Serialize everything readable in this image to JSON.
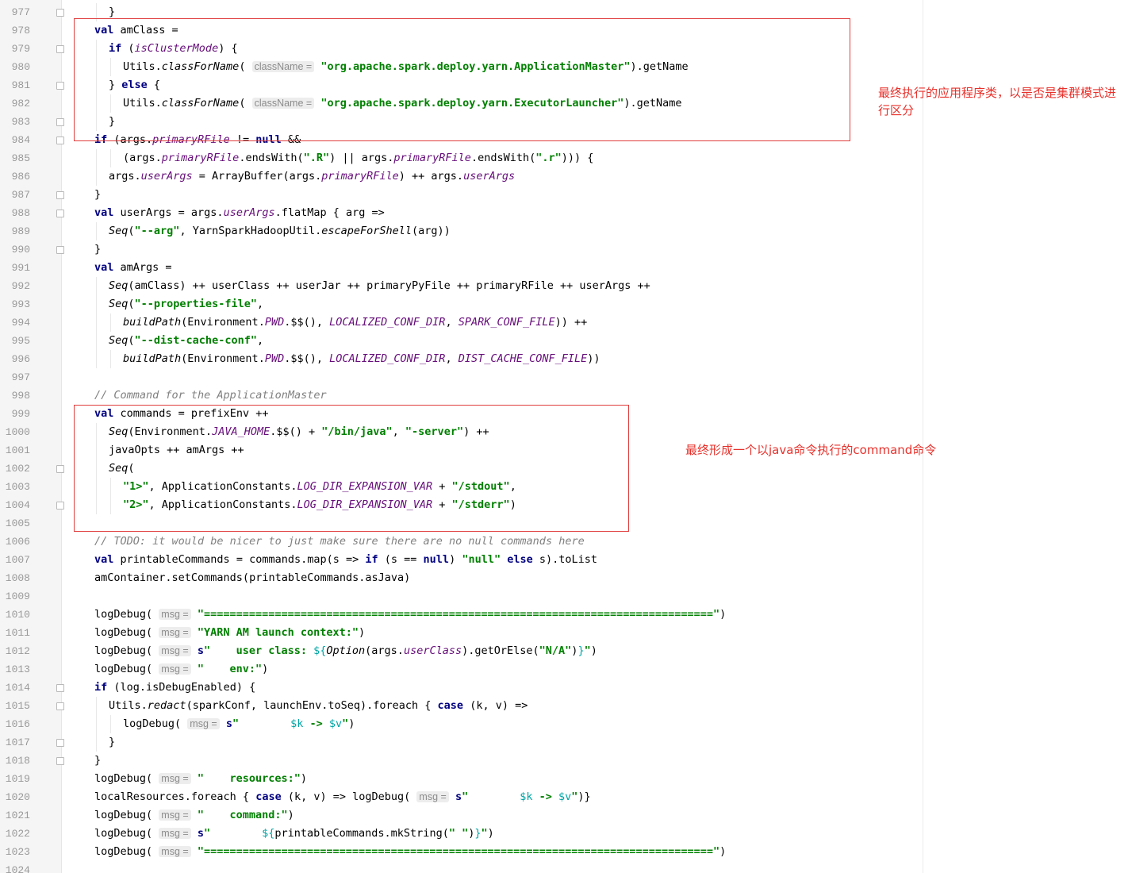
{
  "editor": {
    "lines": [
      {
        "n": "977",
        "i": 1,
        "f": true,
        "t": [
          {
            "x": "}"
          }
        ]
      },
      {
        "n": "978",
        "i": 0,
        "f": false,
        "t": [
          {
            "k": "kw",
            "x": "val"
          },
          {
            "x": " amClass ="
          }
        ]
      },
      {
        "n": "979",
        "i": 1,
        "f": true,
        "t": [
          {
            "k": "kw",
            "x": "if"
          },
          {
            "x": " ("
          },
          {
            "k": "fld",
            "x": "isClusterMode"
          },
          {
            "x": ") {"
          }
        ]
      },
      {
        "n": "980",
        "i": 2,
        "f": false,
        "t": [
          {
            "x": "Utils."
          },
          {
            "k": "fn",
            "x": "classForName"
          },
          {
            "x": "( "
          },
          {
            "k": "hint",
            "x": "className ="
          },
          {
            "x": " "
          },
          {
            "k": "str",
            "x": "\"org.apache.spark.deploy.yarn.ApplicationMaster\""
          },
          {
            "x": ").getName"
          }
        ]
      },
      {
        "n": "981",
        "i": 1,
        "f": true,
        "t": [
          {
            "x": "} "
          },
          {
            "k": "kw",
            "x": "else"
          },
          {
            "x": " {"
          }
        ]
      },
      {
        "n": "982",
        "i": 2,
        "f": false,
        "t": [
          {
            "x": "Utils."
          },
          {
            "k": "fn",
            "x": "classForName"
          },
          {
            "x": "( "
          },
          {
            "k": "hint",
            "x": "className ="
          },
          {
            "x": " "
          },
          {
            "k": "str",
            "x": "\"org.apache.spark.deploy.yarn.ExecutorLauncher\""
          },
          {
            "x": ").getName"
          }
        ]
      },
      {
        "n": "983",
        "i": 1,
        "f": true,
        "t": [
          {
            "x": "}"
          }
        ]
      },
      {
        "n": "984",
        "i": 0,
        "f": true,
        "t": [
          {
            "k": "kw",
            "x": "if"
          },
          {
            "x": " (args."
          },
          {
            "k": "fld",
            "x": "primaryRFile"
          },
          {
            "x": " != "
          },
          {
            "k": "kw",
            "x": "null"
          },
          {
            "x": " &&"
          }
        ]
      },
      {
        "n": "985",
        "i": 2,
        "f": false,
        "t": [
          {
            "x": "(args."
          },
          {
            "k": "fld",
            "x": "primaryRFile"
          },
          {
            "x": ".endsWith("
          },
          {
            "k": "str",
            "x": "\".R\""
          },
          {
            "x": ") || args."
          },
          {
            "k": "fld",
            "x": "primaryRFile"
          },
          {
            "x": ".endsWith("
          },
          {
            "k": "str",
            "x": "\".r\""
          },
          {
            "x": "))) {"
          }
        ]
      },
      {
        "n": "986",
        "i": 1,
        "f": false,
        "t": [
          {
            "x": "args."
          },
          {
            "k": "fld",
            "x": "userArgs"
          },
          {
            "x": " = ArrayBuffer(args."
          },
          {
            "k": "fld",
            "x": "primaryRFile"
          },
          {
            "x": ") ++ args."
          },
          {
            "k": "fld",
            "x": "userArgs"
          }
        ]
      },
      {
        "n": "987",
        "i": 0,
        "f": true,
        "t": [
          {
            "x": "}"
          }
        ]
      },
      {
        "n": "988",
        "i": 0,
        "f": true,
        "t": [
          {
            "k": "kw",
            "x": "val"
          },
          {
            "x": " userArgs = args."
          },
          {
            "k": "fld",
            "x": "userArgs"
          },
          {
            "x": ".flatMap { arg =>"
          }
        ]
      },
      {
        "n": "989",
        "i": 1,
        "f": false,
        "t": [
          {
            "k": "fn",
            "x": "Seq"
          },
          {
            "x": "("
          },
          {
            "k": "str",
            "x": "\"--arg\""
          },
          {
            "x": ", YarnSparkHadoopUtil."
          },
          {
            "k": "fn",
            "x": "escapeForShell"
          },
          {
            "x": "(arg))"
          }
        ]
      },
      {
        "n": "990",
        "i": 0,
        "f": true,
        "t": [
          {
            "x": "}"
          }
        ]
      },
      {
        "n": "991",
        "i": 0,
        "f": false,
        "t": [
          {
            "k": "kw",
            "x": "val"
          },
          {
            "x": " amArgs ="
          }
        ]
      },
      {
        "n": "992",
        "i": 1,
        "f": false,
        "t": [
          {
            "k": "fn",
            "x": "Seq"
          },
          {
            "x": "(amClass) ++ userClass ++ userJar ++ primaryPyFile ++ primaryRFile ++ userArgs ++"
          }
        ]
      },
      {
        "n": "993",
        "i": 1,
        "f": false,
        "t": [
          {
            "k": "fn",
            "x": "Seq"
          },
          {
            "x": "("
          },
          {
            "k": "str",
            "x": "\"--properties-file\""
          },
          {
            "x": ","
          }
        ]
      },
      {
        "n": "994",
        "i": 2,
        "f": false,
        "t": [
          {
            "k": "fn",
            "x": "buildPath"
          },
          {
            "x": "(Environment."
          },
          {
            "k": "fld",
            "x": "PWD"
          },
          {
            "x": ".$$(), "
          },
          {
            "k": "fld",
            "x": "LOCALIZED_CONF_DIR"
          },
          {
            "x": ", "
          },
          {
            "k": "fld",
            "x": "SPARK_CONF_FILE"
          },
          {
            "x": ")) ++"
          }
        ]
      },
      {
        "n": "995",
        "i": 1,
        "f": false,
        "t": [
          {
            "k": "fn",
            "x": "Seq"
          },
          {
            "x": "("
          },
          {
            "k": "str",
            "x": "\"--dist-cache-conf\""
          },
          {
            "x": ","
          }
        ]
      },
      {
        "n": "996",
        "i": 2,
        "f": false,
        "t": [
          {
            "k": "fn",
            "x": "buildPath"
          },
          {
            "x": "(Environment."
          },
          {
            "k": "fld",
            "x": "PWD"
          },
          {
            "x": ".$$(), "
          },
          {
            "k": "fld",
            "x": "LOCALIZED_CONF_DIR"
          },
          {
            "x": ", "
          },
          {
            "k": "fld",
            "x": "DIST_CACHE_CONF_FILE"
          },
          {
            "x": "))"
          }
        ]
      },
      {
        "n": "997",
        "i": 0,
        "f": false,
        "t": []
      },
      {
        "n": "998",
        "i": 0,
        "f": false,
        "t": [
          {
            "k": "cm",
            "x": "// Command for the ApplicationMaster"
          }
        ]
      },
      {
        "n": "999",
        "i": 0,
        "f": false,
        "t": [
          {
            "k": "kw",
            "x": "val"
          },
          {
            "x": " commands = prefixEnv ++"
          }
        ]
      },
      {
        "n": "1000",
        "i": 1,
        "f": false,
        "t": [
          {
            "k": "fn",
            "x": "Seq"
          },
          {
            "x": "(Environment."
          },
          {
            "k": "fld",
            "x": "JAVA_HOME"
          },
          {
            "x": ".$$() + "
          },
          {
            "k": "str",
            "x": "\"/bin/java\""
          },
          {
            "x": ", "
          },
          {
            "k": "str",
            "x": "\"-server\""
          },
          {
            "x": ") ++"
          }
        ]
      },
      {
        "n": "1001",
        "i": 1,
        "f": false,
        "t": [
          {
            "x": "javaOpts ++ amArgs ++"
          }
        ]
      },
      {
        "n": "1002",
        "i": 1,
        "f": true,
        "t": [
          {
            "k": "fn",
            "x": "Seq"
          },
          {
            "x": "("
          }
        ]
      },
      {
        "n": "1003",
        "i": 2,
        "f": false,
        "t": [
          {
            "k": "str",
            "x": "\"1>\""
          },
          {
            "x": ", ApplicationConstants."
          },
          {
            "k": "fld",
            "x": "LOG_DIR_EXPANSION_VAR"
          },
          {
            "x": " + "
          },
          {
            "k": "str",
            "x": "\"/stdout\""
          },
          {
            "x": ","
          }
        ]
      },
      {
        "n": "1004",
        "i": 2,
        "f": true,
        "t": [
          {
            "k": "str",
            "x": "\"2>\""
          },
          {
            "x": ", ApplicationConstants."
          },
          {
            "k": "fld",
            "x": "LOG_DIR_EXPANSION_VAR"
          },
          {
            "x": " + "
          },
          {
            "k": "str",
            "x": "\"/stderr\""
          },
          {
            "x": ")"
          }
        ]
      },
      {
        "n": "1005",
        "i": 0,
        "f": false,
        "t": []
      },
      {
        "n": "1006",
        "i": 0,
        "f": false,
        "t": [
          {
            "k": "cm",
            "x": "// TODO: it would be nicer to just make sure there are no null commands here"
          }
        ]
      },
      {
        "n": "1007",
        "i": 0,
        "f": false,
        "t": [
          {
            "k": "kw",
            "x": "val"
          },
          {
            "x": " printableCommands = commands.map(s => "
          },
          {
            "k": "kw",
            "x": "if"
          },
          {
            "x": " (s == "
          },
          {
            "k": "kw",
            "x": "null"
          },
          {
            "x": ") "
          },
          {
            "k": "str",
            "x": "\"null\""
          },
          {
            "x": " "
          },
          {
            "k": "kw",
            "x": "else"
          },
          {
            "x": " s).toList"
          }
        ]
      },
      {
        "n": "1008",
        "i": 0,
        "f": false,
        "t": [
          {
            "x": "amContainer.setCommands(printableCommands.asJava)"
          }
        ]
      },
      {
        "n": "1009",
        "i": 0,
        "f": false,
        "t": []
      },
      {
        "n": "1010",
        "i": 0,
        "f": false,
        "t": [
          {
            "x": "logDebug( "
          },
          {
            "k": "hint",
            "x": "msg ="
          },
          {
            "x": " "
          },
          {
            "k": "str",
            "x": "\"===============================================================================\""
          },
          {
            "x": ")"
          }
        ]
      },
      {
        "n": "1011",
        "i": 0,
        "f": false,
        "t": [
          {
            "x": "logDebug( "
          },
          {
            "k": "hint",
            "x": "msg ="
          },
          {
            "x": " "
          },
          {
            "k": "str",
            "x": "\"YARN AM launch context:\""
          },
          {
            "x": ")"
          }
        ]
      },
      {
        "n": "1012",
        "i": 0,
        "f": false,
        "t": [
          {
            "x": "logDebug( "
          },
          {
            "k": "hint",
            "x": "msg ="
          },
          {
            "x": " "
          },
          {
            "k": "kw",
            "x": "s"
          },
          {
            "k": "str",
            "x": "\"    user class: "
          },
          {
            "k": "ip",
            "x": "${"
          },
          {
            "k": "fn",
            "x": "Option"
          },
          {
            "x": "(args."
          },
          {
            "k": "fld",
            "x": "userClass"
          },
          {
            "x": ").getOrElse("
          },
          {
            "k": "str",
            "x": "\"N/A\""
          },
          {
            "x": ")"
          },
          {
            "k": "ip",
            "x": "}"
          },
          {
            "k": "str",
            "x": "\""
          },
          {
            "x": ")"
          }
        ]
      },
      {
        "n": "1013",
        "i": 0,
        "f": false,
        "t": [
          {
            "x": "logDebug( "
          },
          {
            "k": "hint",
            "x": "msg ="
          },
          {
            "x": " "
          },
          {
            "k": "str",
            "x": "\"    env:\""
          },
          {
            "x": ")"
          }
        ]
      },
      {
        "n": "1014",
        "i": 0,
        "f": true,
        "t": [
          {
            "k": "kw",
            "x": "if"
          },
          {
            "x": " (log.isDebugEnabled) {"
          }
        ]
      },
      {
        "n": "1015",
        "i": 1,
        "f": true,
        "t": [
          {
            "x": "Utils."
          },
          {
            "k": "fn",
            "x": "redact"
          },
          {
            "x": "(sparkConf, launchEnv.toSeq).foreach { "
          },
          {
            "k": "kw",
            "x": "case"
          },
          {
            "x": " (k, v) =>"
          }
        ]
      },
      {
        "n": "1016",
        "i": 2,
        "f": false,
        "t": [
          {
            "x": "logDebug( "
          },
          {
            "k": "hint",
            "x": "msg ="
          },
          {
            "x": " "
          },
          {
            "k": "kw",
            "x": "s"
          },
          {
            "k": "str",
            "x": "\"        "
          },
          {
            "k": "ip",
            "x": "$k"
          },
          {
            "k": "str",
            "x": " -> "
          },
          {
            "k": "ip",
            "x": "$v"
          },
          {
            "k": "str",
            "x": "\""
          },
          {
            "x": ")"
          }
        ]
      },
      {
        "n": "1017",
        "i": 1,
        "f": true,
        "t": [
          {
            "x": "}"
          }
        ]
      },
      {
        "n": "1018",
        "i": 0,
        "f": true,
        "t": [
          {
            "x": "}"
          }
        ]
      },
      {
        "n": "1019",
        "i": 0,
        "f": false,
        "t": [
          {
            "x": "logDebug( "
          },
          {
            "k": "hint",
            "x": "msg ="
          },
          {
            "x": " "
          },
          {
            "k": "str",
            "x": "\"    resources:\""
          },
          {
            "x": ")"
          }
        ]
      },
      {
        "n": "1020",
        "i": 0,
        "f": false,
        "t": [
          {
            "x": "localResources.foreach { "
          },
          {
            "k": "kw",
            "x": "case"
          },
          {
            "x": " (k, v) => logDebug( "
          },
          {
            "k": "hint",
            "x": "msg ="
          },
          {
            "x": " "
          },
          {
            "k": "kw",
            "x": "s"
          },
          {
            "k": "str",
            "x": "\"        "
          },
          {
            "k": "ip",
            "x": "$k"
          },
          {
            "k": "str",
            "x": " -> "
          },
          {
            "k": "ip",
            "x": "$v"
          },
          {
            "k": "str",
            "x": "\""
          },
          {
            "x": ")}"
          }
        ]
      },
      {
        "n": "1021",
        "i": 0,
        "f": false,
        "t": [
          {
            "x": "logDebug( "
          },
          {
            "k": "hint",
            "x": "msg ="
          },
          {
            "x": " "
          },
          {
            "k": "str",
            "x": "\"    command:\""
          },
          {
            "x": ")"
          }
        ]
      },
      {
        "n": "1022",
        "i": 0,
        "f": false,
        "t": [
          {
            "x": "logDebug( "
          },
          {
            "k": "hint",
            "x": "msg ="
          },
          {
            "x": " "
          },
          {
            "k": "kw",
            "x": "s"
          },
          {
            "k": "str",
            "x": "\"        "
          },
          {
            "k": "ip",
            "x": "${"
          },
          {
            "x": "printableCommands.mkString("
          },
          {
            "k": "str",
            "x": "\" \""
          },
          {
            "x": ")"
          },
          {
            "k": "ip",
            "x": "}"
          },
          {
            "k": "str",
            "x": "\""
          },
          {
            "x": ")"
          }
        ]
      },
      {
        "n": "1023",
        "i": 0,
        "f": false,
        "t": [
          {
            "x": "logDebug( "
          },
          {
            "k": "hint",
            "x": "msg ="
          },
          {
            "x": " "
          },
          {
            "k": "str",
            "x": "\"===============================================================================\""
          },
          {
            "x": ")"
          }
        ]
      },
      {
        "n": "1024",
        "i": 0,
        "f": false,
        "t": []
      }
    ]
  },
  "annotations": {
    "am_class_note": "最终执行的应用程序类，以是否是集群模式进行区分",
    "command_note": "最终形成一个以java命令执行的command命令"
  },
  "colors": {
    "keyword": "#000080",
    "string": "#008000",
    "field": "#660e7a",
    "comment": "#808080",
    "interpolation": "#00a5a5",
    "annotation": "#e8312b"
  }
}
